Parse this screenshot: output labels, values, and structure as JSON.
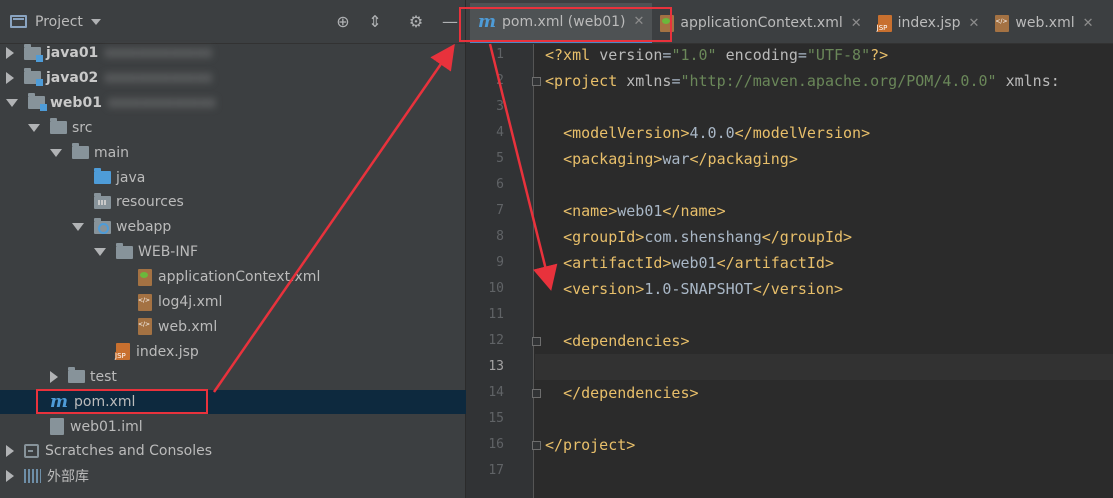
{
  "project_panel": {
    "title": "Project",
    "tree": [
      {
        "label": "java01",
        "level": 0,
        "expand": "collapsed",
        "icon": "module-folder",
        "bold": true,
        "blurred_suffix": "xxxxxxxxxxxxx"
      },
      {
        "label": "java02",
        "level": 0,
        "expand": "collapsed",
        "icon": "module-folder",
        "bold": true,
        "blurred_suffix": "xxxxxxxxxxxxx"
      },
      {
        "label": "web01",
        "level": 0,
        "expand": "expanded",
        "icon": "module-folder",
        "bold": true,
        "blurred_suffix": "xxxxxxxxxxxxx"
      },
      {
        "label": "src",
        "level": 1,
        "expand": "expanded",
        "icon": "folder"
      },
      {
        "label": "main",
        "level": 2,
        "expand": "expanded",
        "icon": "folder"
      },
      {
        "label": "java",
        "level": 3,
        "expand": "none",
        "icon": "source-folder"
      },
      {
        "label": "resources",
        "level": 3,
        "expand": "none",
        "icon": "resources-folder"
      },
      {
        "label": "webapp",
        "level": 3,
        "expand": "expanded",
        "icon": "web-folder"
      },
      {
        "label": "WEB-INF",
        "level": 4,
        "expand": "expanded",
        "icon": "folder"
      },
      {
        "label": "applicationContext.xml",
        "level": 5,
        "expand": "none",
        "icon": "spring-xml"
      },
      {
        "label": "log4j.xml",
        "level": 5,
        "expand": "none",
        "icon": "xml"
      },
      {
        "label": "web.xml",
        "level": 5,
        "expand": "none",
        "icon": "web-xml"
      },
      {
        "label": "index.jsp",
        "level": 4,
        "expand": "none",
        "icon": "jsp"
      },
      {
        "label": "test",
        "level": 2,
        "expand": "collapsed",
        "icon": "folder"
      },
      {
        "label": "pom.xml",
        "level": 1,
        "expand": "none",
        "icon": "maven",
        "selected": true
      },
      {
        "label": "web01.iml",
        "level": 1,
        "expand": "none",
        "icon": "iml"
      },
      {
        "label": "Scratches and Consoles",
        "level": 0,
        "expand": "collapsed",
        "icon": "scratches"
      },
      {
        "label": "外部库",
        "level": 0,
        "expand": "collapsed",
        "icon": "libraries"
      }
    ]
  },
  "editor": {
    "tabs": [
      {
        "label": "pom.xml (web01)",
        "icon": "maven",
        "active": true,
        "closable": true
      },
      {
        "label": "applicationContext.xml",
        "icon": "spring-xml",
        "active": false,
        "closable": true
      },
      {
        "label": "index.jsp",
        "icon": "jsp",
        "active": false,
        "closable": true
      },
      {
        "label": "web.xml",
        "icon": "web-xml",
        "active": false,
        "closable": true
      }
    ],
    "current_line": 13,
    "lines": [
      {
        "n": "1",
        "tokens": [
          [
            "tg",
            "<?xml "
          ],
          [
            "at",
            "version"
          ],
          [
            "tx",
            "="
          ],
          [
            "av",
            "\"1.0\""
          ],
          [
            "tx",
            " "
          ],
          [
            "at",
            "encoding"
          ],
          [
            "tx",
            "="
          ],
          [
            "av",
            "\"UTF-8\""
          ],
          [
            "tg",
            "?>"
          ]
        ]
      },
      {
        "n": "2",
        "tokens": [
          [
            "tg",
            "<project "
          ],
          [
            "at",
            "xmlns"
          ],
          [
            "tx",
            "="
          ],
          [
            "av",
            "\"http://maven.apache.org/POM/4.0.0\""
          ],
          [
            "tx",
            " "
          ],
          [
            "at",
            "xmlns:"
          ]
        ]
      },
      {
        "n": "3",
        "tokens": []
      },
      {
        "n": "4",
        "tokens": [
          [
            "tx",
            "  "
          ],
          [
            "tg",
            "<modelVersion>"
          ],
          [
            "tx",
            "4.0.0"
          ],
          [
            "tg",
            "</modelVersion>"
          ]
        ]
      },
      {
        "n": "5",
        "tokens": [
          [
            "tx",
            "  "
          ],
          [
            "tg",
            "<packaging>"
          ],
          [
            "tx",
            "war"
          ],
          [
            "tg",
            "</packaging>"
          ]
        ]
      },
      {
        "n": "6",
        "tokens": []
      },
      {
        "n": "7",
        "tokens": [
          [
            "tx",
            "  "
          ],
          [
            "tg",
            "<name>"
          ],
          [
            "tx",
            "web01"
          ],
          [
            "tg",
            "</name>"
          ]
        ]
      },
      {
        "n": "8",
        "tokens": [
          [
            "tx",
            "  "
          ],
          [
            "tg",
            "<groupId>"
          ],
          [
            "tx",
            "com.shenshang"
          ],
          [
            "tg",
            "</groupId>"
          ]
        ]
      },
      {
        "n": "9",
        "tokens": [
          [
            "tx",
            "  "
          ],
          [
            "tg",
            "<artifactId>"
          ],
          [
            "tx",
            "web01"
          ],
          [
            "tg",
            "</artifactId>"
          ]
        ]
      },
      {
        "n": "10",
        "tokens": [
          [
            "tx",
            "  "
          ],
          [
            "tg",
            "<version>"
          ],
          [
            "tx",
            "1.0-SNAPSHOT"
          ],
          [
            "tg",
            "</version>"
          ]
        ]
      },
      {
        "n": "11",
        "tokens": []
      },
      {
        "n": "12",
        "tokens": [
          [
            "tx",
            "  "
          ],
          [
            "tg",
            "<dependencies>"
          ]
        ]
      },
      {
        "n": "13",
        "tokens": []
      },
      {
        "n": "14",
        "tokens": [
          [
            "tx",
            "  "
          ],
          [
            "tg",
            "</dependencies>"
          ]
        ]
      },
      {
        "n": "15",
        "tokens": []
      },
      {
        "n": "16",
        "tokens": [
          [
            "tg",
            "</project>"
          ]
        ]
      },
      {
        "n": "17",
        "tokens": []
      }
    ]
  },
  "colors": {
    "tag": "#e8bf6a",
    "attr": "#bababa",
    "attr_value": "#6a8759",
    "text": "#a9b7c6",
    "annotation": "#e8323c",
    "selection": "#0d293e"
  }
}
